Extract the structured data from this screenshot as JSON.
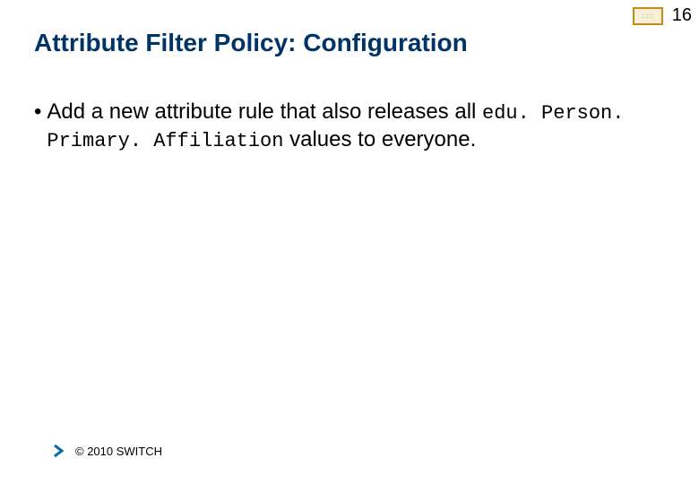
{
  "slide": {
    "number": "16",
    "title": "Attribute Filter Policy: Configuration",
    "bullet": {
      "marker": "•",
      "text_pre": "Add a new attribute rule that also releases all ",
      "code": "edu. Person. Primary. Affiliation",
      "text_post": " values to everyone."
    },
    "footer": "© 2010 SWITCH"
  }
}
